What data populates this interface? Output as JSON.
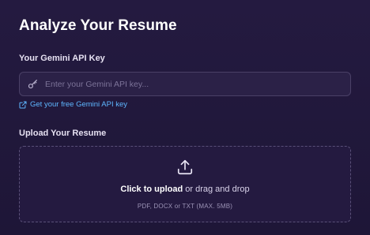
{
  "page": {
    "title": "Analyze Your Resume"
  },
  "api_key": {
    "label": "Your Gemini API Key",
    "value": "",
    "placeholder": "Enter your Gemini API key...",
    "icon": "key-icon",
    "free_link_label": "Get your free Gemini API key",
    "free_link_icon": "external-link-icon"
  },
  "upload": {
    "label": "Upload Your Resume",
    "icon": "upload-icon",
    "click_text": "Click to upload",
    "drag_text": " or drag and drop",
    "hint": "PDF, DOCX or TXT (MAX. 5MB)"
  },
  "colors": {
    "background": "#1f1538",
    "input_bg": "#2b2147",
    "input_border": "#4a4066",
    "link": "#5eb6ff",
    "dashed_border": "#5a5078"
  }
}
